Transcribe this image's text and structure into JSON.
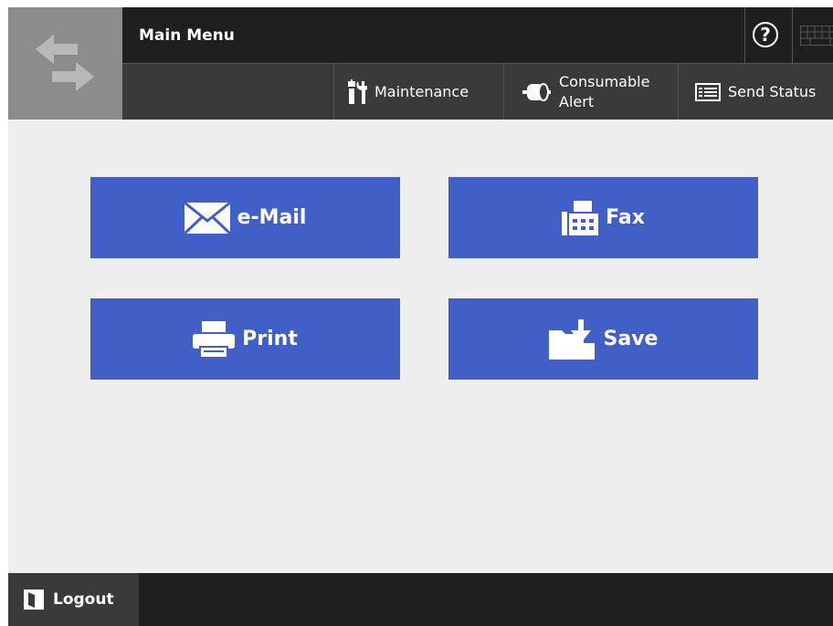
{
  "header": {
    "title": "Main Menu",
    "help_label": "?"
  },
  "toolbar": {
    "maintenance_label": "Maintenance",
    "consumable_line1": "Consumable",
    "consumable_line2": "Alert",
    "send_status_label": "Send Status"
  },
  "menu": {
    "email_label": "e-Mail",
    "fax_label": "Fax",
    "print_label": "Print",
    "save_label": "Save"
  },
  "footer": {
    "logout_label": "Logout"
  },
  "colors": {
    "accent": "#4060c8",
    "header_dark": "#1f1f1f",
    "header_mid": "#3a3a3a",
    "logo_panel": "#8c8c8c",
    "background": "#eeeeee"
  },
  "icons": {
    "logo": "swap-arrows-icon",
    "help": "help-icon",
    "keyboard": "keyboard-icon",
    "maintenance": "tools-icon",
    "consumable": "toner-roll-icon",
    "send_status": "list-icon",
    "email": "envelope-icon",
    "fax": "fax-icon",
    "print": "printer-icon",
    "save": "folder-download-icon",
    "logout": "logout-icon"
  }
}
